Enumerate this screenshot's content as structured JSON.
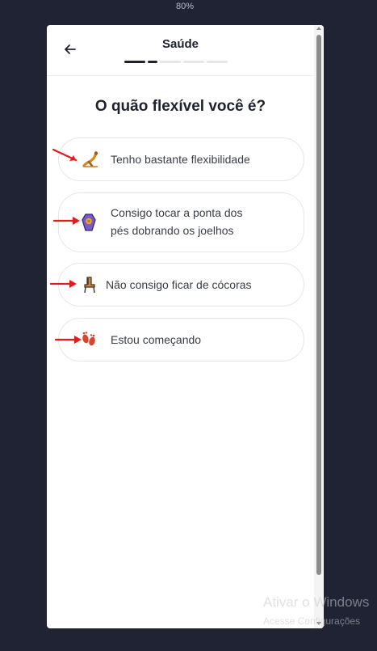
{
  "browser": {
    "zoom": "80%"
  },
  "header": {
    "title": "Saúde",
    "progress_steps": [
      true,
      true,
      false,
      false,
      false
    ]
  },
  "question": "O quão flexível você é?",
  "options": [
    {
      "label_lines": [
        "Tenho bastante flexibilidade"
      ],
      "icon": "flexibility-pose-icon",
      "color": "#d08a22"
    },
    {
      "label_lines": [
        "Consigo tocar a ponta dos",
        "pés dobrando os joelhos"
      ],
      "icon": "coffin-icon",
      "color": "#7b59c9"
    },
    {
      "label_lines": [
        "Não consigo ficar de cócoras"
      ],
      "icon": "chair-icon",
      "color": "#b07a48"
    },
    {
      "label_lines": [
        "Estou começando"
      ],
      "icon": "footprints-icon",
      "color": "#d9452c"
    }
  ],
  "annotations": {
    "arrow_color": "#e31b1b"
  },
  "watermark": {
    "line1": "Ativar o Windows",
    "line2": "Acesse Configurações"
  }
}
